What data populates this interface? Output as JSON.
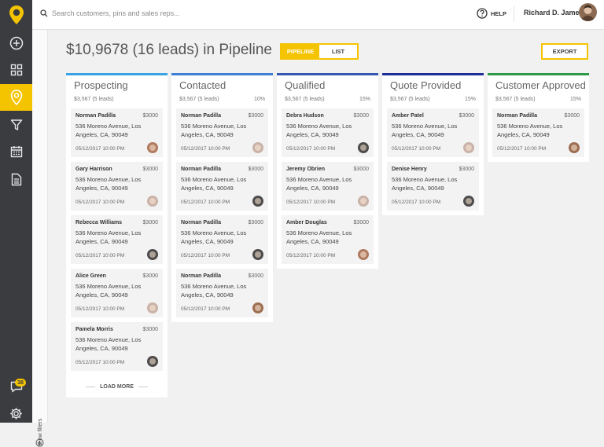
{
  "search": {
    "placeholder": "Search customers, pins and sales reps..."
  },
  "topbar": {
    "help_label": "HELP",
    "user_name": "Richard D. James"
  },
  "sidebar": {
    "items": [
      {
        "name": "add",
        "icon": "plus-circle-icon"
      },
      {
        "name": "dashboard",
        "icon": "grid-icon"
      },
      {
        "name": "pipeline",
        "icon": "map-pin-icon",
        "active": true
      },
      {
        "name": "filter",
        "icon": "funnel-icon"
      },
      {
        "name": "calendar",
        "icon": "calendar-icon"
      },
      {
        "name": "documents",
        "icon": "document-icon"
      }
    ],
    "chat_badge": "38",
    "show_filters": "Show filters"
  },
  "header": {
    "title": "$10,9678 (16 leads) in Pipeline",
    "view_pipeline": "PIPELINE",
    "view_list": "LIST",
    "export": "EXPORT"
  },
  "colors": {
    "accent": "#f5c400",
    "sidebar": "#3a3c40",
    "prospecting": "#3aa3e3",
    "contacted": "#3f7fd6",
    "qualified": "#3659b0",
    "quote_provided": "#1f2f9a",
    "customer_approved": "#2e9a47"
  },
  "columns": [
    {
      "title": "Prospecting",
      "amount": "$3,567 (5 leads)",
      "percent": "",
      "cards": [
        {
          "name": "Norman Padilla",
          "price": "$3000",
          "address": "536 Moreno Avenue, Los Angeles, CA, 90049",
          "date": "05/12/2017  10:00 PM"
        },
        {
          "name": "Gary Harrison",
          "price": "$3000",
          "address": "536 Moreno Avenue, Los Angeles, CA, 90049",
          "date": "05/12/2017  10:00 PM"
        },
        {
          "name": "Rebecca Williams",
          "price": "$3000",
          "address": "536 Moreno Avenue, Los Angeles, CA, 90049",
          "date": "05/12/2017  10:00 PM"
        },
        {
          "name": "Alice Green",
          "price": "$3000",
          "address": "536 Moreno Avenue, Los Angeles, CA, 90049",
          "date": "05/12/2017  10:00 PM"
        },
        {
          "name": "Pamela Morris",
          "price": "$3000",
          "address": "536 Moreno Avenue, Los Angeles, CA, 90049",
          "date": "05/12/2017  10:00 PM"
        }
      ],
      "load_more": "LOAD MORE"
    },
    {
      "title": "Contacted",
      "amount": "$3,567 (5 leads)",
      "percent": "10%",
      "cards": [
        {
          "name": "Norman Padilla",
          "price": "$3000",
          "address": "536 Moreno Avenue, Los Angeles, CA, 90049",
          "date": "05/12/2017  10:00 PM"
        },
        {
          "name": "Norman Padilla",
          "price": "$3000",
          "address": "536 Moreno Avenue, Los Angeles, CA, 90049",
          "date": "05/12/2017  10:00 PM"
        },
        {
          "name": "Norman Padilla",
          "price": "$3000",
          "address": "536 Moreno Avenue, Los Angeles, CA, 90049",
          "date": "05/12/2017  10:00 PM"
        },
        {
          "name": "Norman Padilla",
          "price": "$3000",
          "address": "536 Moreno Avenue, Los Angeles, CA, 90049",
          "date": "05/12/2017  10:00 PM"
        }
      ]
    },
    {
      "title": "Qualified",
      "amount": "$3,567 (5 leads)",
      "percent": "15%",
      "cards": [
        {
          "name": "Debra Hudson",
          "price": "$3000",
          "address": "536 Moreno Avenue, Los Angeles, CA, 90049",
          "date": "05/12/2017  10:00 PM"
        },
        {
          "name": "Jeremy Obrien",
          "price": "$3000",
          "address": "536 Moreno Avenue, Los Angeles, CA, 90049",
          "date": "05/12/2017  10:00 PM"
        },
        {
          "name": "Amber Douglas",
          "price": "$3000",
          "address": "536 Moreno Avenue, Los Angeles, CA, 90049",
          "date": "05/12/2017  10:00 PM"
        }
      ]
    },
    {
      "title": "Quote Provided",
      "amount": "$3,567 (5 leads)",
      "percent": "15%",
      "cards": [
        {
          "name": "Amber Patel",
          "price": "$3000",
          "address": "536 Moreno Avenue, Los Angeles, CA, 90049",
          "date": "05/12/2017  10:00 PM"
        },
        {
          "name": "Denise Henry",
          "price": "$3000",
          "address": "536 Moreno Avenue, Los Angeles, CA, 90049",
          "date": "05/12/2017  10:00 PM"
        }
      ]
    },
    {
      "title": "Customer Approved",
      "amount": "$3,567 (5 leads)",
      "percent": "15%",
      "cards": [
        {
          "name": "Norman Padilla",
          "price": "$3000",
          "address": "536 Moreno Avenue, Los Angeles, CA, 90049",
          "date": "05/12/2017  10:00 PM"
        }
      ]
    }
  ]
}
